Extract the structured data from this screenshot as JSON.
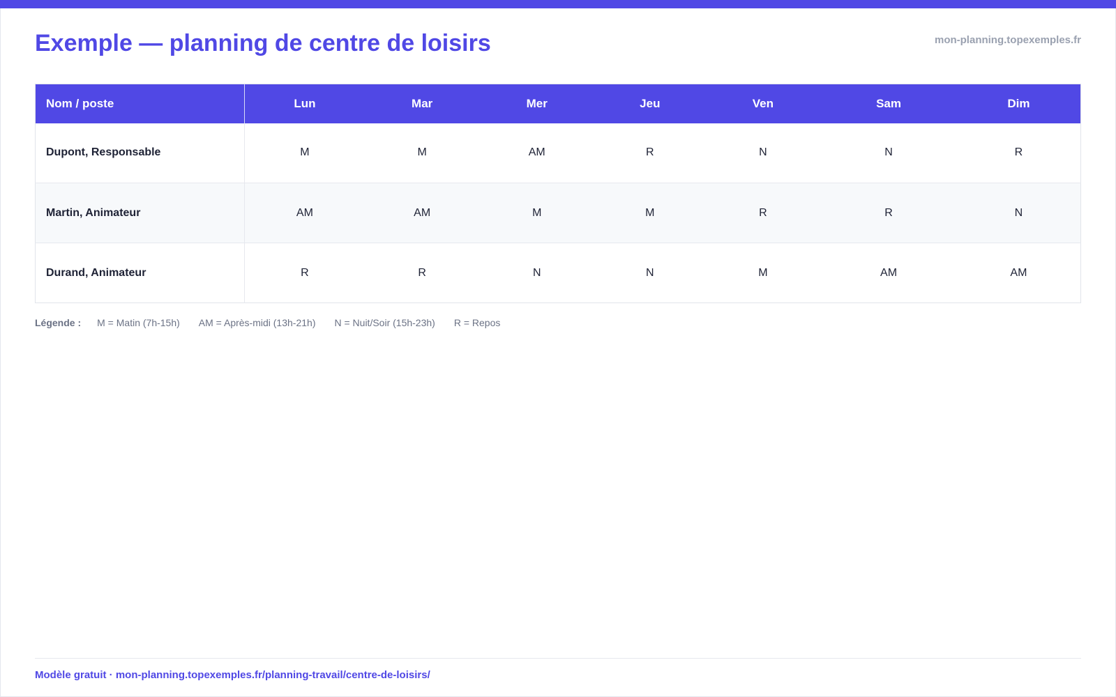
{
  "header": {
    "title": "Exemple — planning de centre de loisirs",
    "site": "mon-planning.topexemples.fr"
  },
  "table": {
    "columns": [
      "Nom / poste",
      "Lun",
      "Mar",
      "Mer",
      "Jeu",
      "Ven",
      "Sam",
      "Dim"
    ],
    "rows": [
      {
        "name": "Dupont, Responsable",
        "shifts": [
          "M",
          "M",
          "AM",
          "R",
          "N",
          "N",
          "R"
        ]
      },
      {
        "name": "Martin, Animateur",
        "shifts": [
          "AM",
          "AM",
          "M",
          "M",
          "R",
          "R",
          "N"
        ]
      },
      {
        "name": "Durand, Animateur",
        "shifts": [
          "R",
          "R",
          "N",
          "N",
          "M",
          "AM",
          "AM"
        ]
      }
    ]
  },
  "legend": {
    "title": "Légende :",
    "items": [
      "M = Matin (7h-15h)",
      "AM = Après-midi (13h-21h)",
      "N = Nuit/Soir (15h-23h)",
      "R = Repos"
    ]
  },
  "footer": {
    "text": "Modèle gratuit · mon-planning.topexemples.fr/planning-travail/centre-de-loisirs/"
  },
  "colors": {
    "accent": "#5048e5",
    "alt_row": "#f7f9fb",
    "muted_text": "#6b7285"
  }
}
